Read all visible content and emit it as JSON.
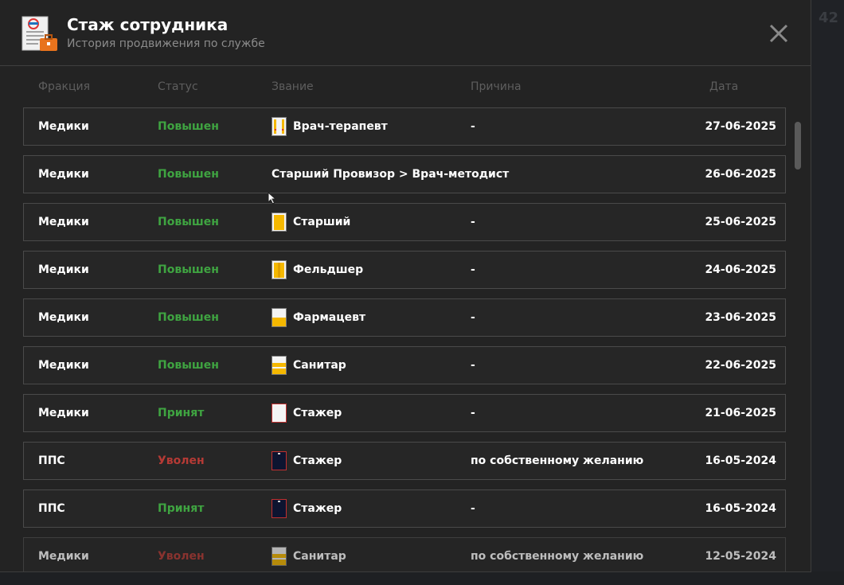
{
  "header": {
    "title": "Стаж сотрудника",
    "subtitle": "История продвижения по службе"
  },
  "columns": {
    "faction": "Фракция",
    "status": "Статус",
    "rank": "Звание",
    "reason": "Причина",
    "date": "Дата"
  },
  "background": {
    "number": "42"
  },
  "colors": {
    "promoted": "#3fa441",
    "dismissed": "#b53a35",
    "accent_yellow": "#f5b800"
  },
  "rows": [
    {
      "faction": "Медики",
      "status": "Повышен",
      "rank": "Врач-терапевт",
      "reason": "-",
      "date": "27-06-2025"
    },
    {
      "faction": "Медики",
      "status": "Повышен",
      "rank": "Старший Провизор > Врач-методист",
      "reason": "",
      "date": "26-06-2025"
    },
    {
      "faction": "Медики",
      "status": "Повышен",
      "rank": "Старший",
      "reason": "-",
      "date": "25-06-2025"
    },
    {
      "faction": "Медики",
      "status": "Повышен",
      "rank": "Фельдшер",
      "reason": "-",
      "date": "24-06-2025"
    },
    {
      "faction": "Медики",
      "status": "Повышен",
      "rank": "Фармацевт",
      "reason": "-",
      "date": "23-06-2025"
    },
    {
      "faction": "Медики",
      "status": "Повышен",
      "rank": "Санитар",
      "reason": "-",
      "date": "22-06-2025"
    },
    {
      "faction": "Медики",
      "status": "Принят",
      "rank": "Стажер",
      "reason": "-",
      "date": "21-06-2025"
    },
    {
      "faction": "ППС",
      "status": "Уволен",
      "rank": "Стажер",
      "reason": "по собственному желанию",
      "date": "16-05-2024"
    },
    {
      "faction": "ППС",
      "status": "Принят",
      "rank": "Стажер",
      "reason": "-",
      "date": "16-05-2024"
    },
    {
      "faction": "Медики",
      "status": "Уволен",
      "rank": "Санитар",
      "reason": "по собственному желанию",
      "date": "12-05-2024"
    }
  ]
}
